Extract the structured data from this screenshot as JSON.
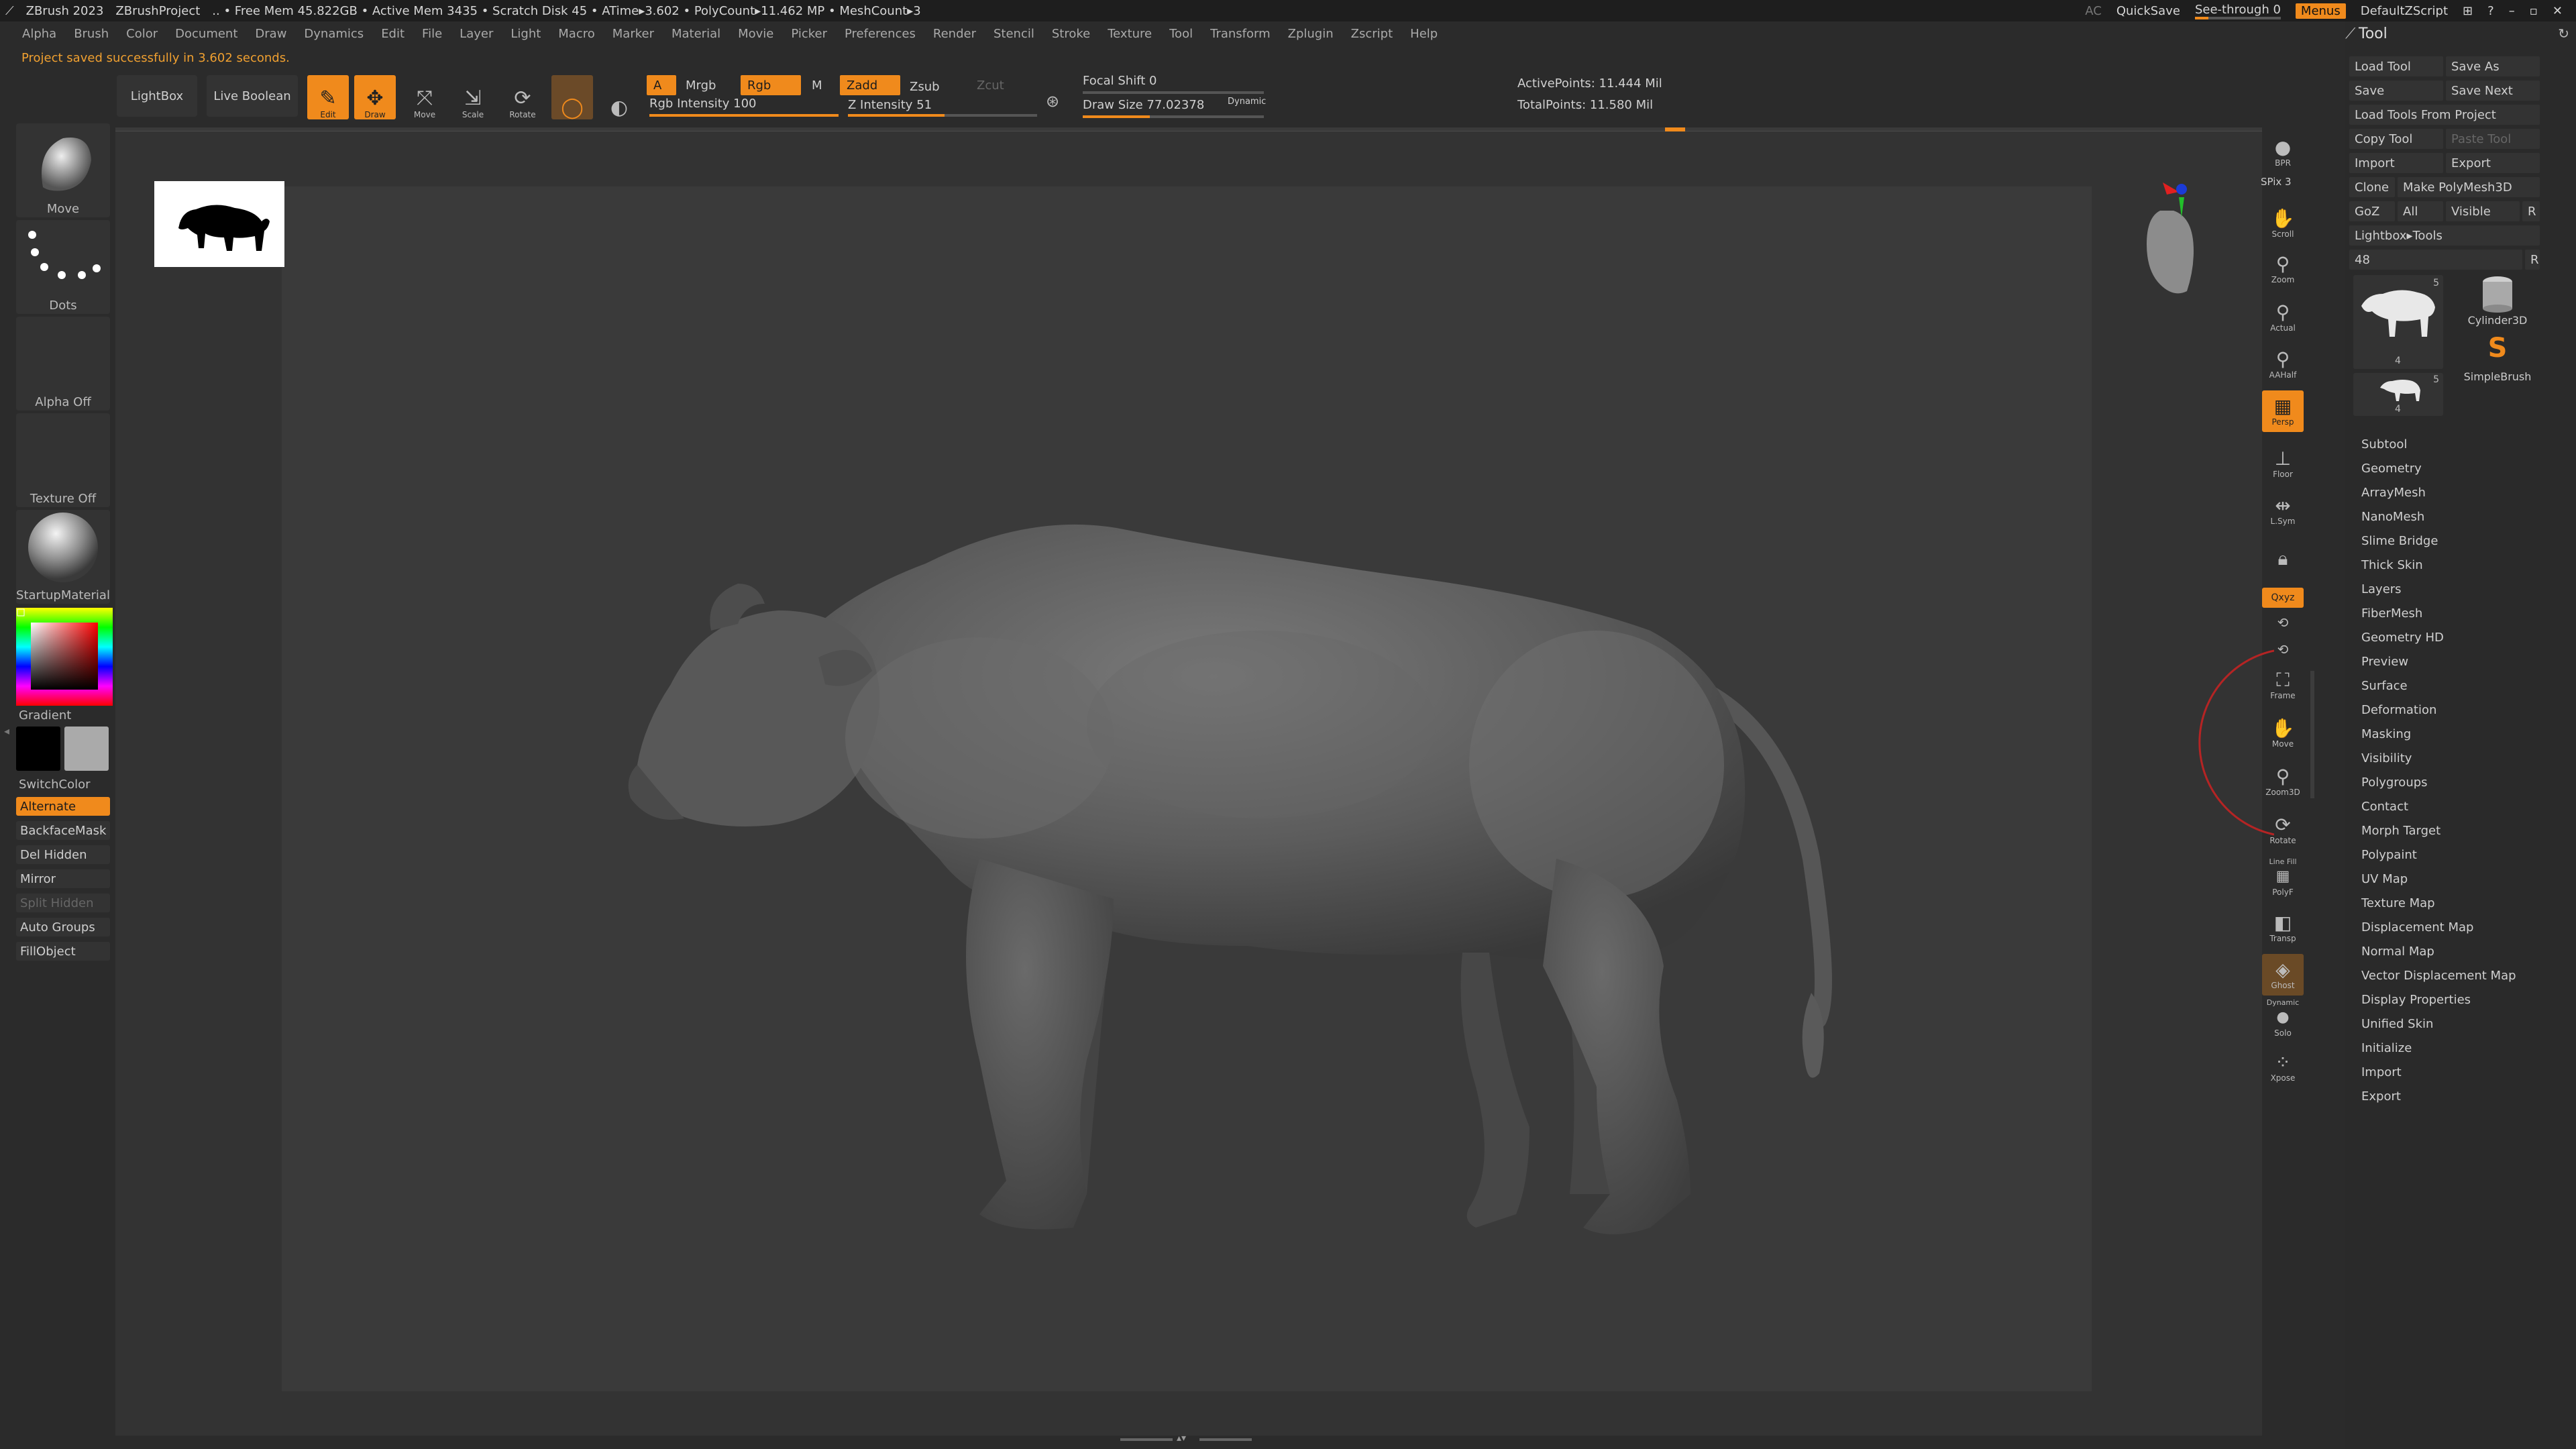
{
  "titlebar": {
    "app": "ZBrush 2023",
    "project": "ZBrushProject",
    "stats": ".. • Free Mem 45.822GB • Active Mem 3435 • Scratch Disk 45 • ATime▸3.602 • PolyCount▸11.462 MP • MeshCount▸3",
    "ac": "AC",
    "quicksave": "QuickSave",
    "seethrough": "See-through  0",
    "menus": "Menus",
    "script": "DefaultZScript"
  },
  "menubar": [
    "Alpha",
    "Brush",
    "Color",
    "Document",
    "Draw",
    "Dynamics",
    "Edit",
    "File",
    "Layer",
    "Light",
    "Macro",
    "Marker",
    "Material",
    "Movie",
    "Picker",
    "Preferences",
    "Render",
    "Stencil",
    "Stroke",
    "Texture",
    "Tool",
    "Transform",
    "Zplugin",
    "Zscript",
    "Help"
  ],
  "status": "Project saved successfully in 3.602 seconds.",
  "toolbar": {
    "lightbox": "LightBox",
    "live_boolean": "Live Boolean",
    "edit": "Edit",
    "draw": "Draw",
    "move": "Move",
    "scale": "Scale",
    "rotate": "Rotate",
    "a": "A",
    "mrgb": "Mrgb",
    "rgb": "Rgb",
    "m": "M",
    "zadd": "Zadd",
    "zsub": "Zsub",
    "zcut": "Zcut",
    "rgb_intensity": "Rgb Intensity 100",
    "z_intensity": "Z Intensity 51",
    "focal_shift": "Focal Shift 0",
    "draw_size": "Draw Size 77.02378",
    "dynamic": "Dynamic",
    "active_points": "ActivePoints: 11.444  Mil",
    "total_points": "TotalPoints: 11.580  Mil",
    "rgb_intensity_value": 100,
    "z_intensity_value": 51
  },
  "leftshelf": {
    "brush": "Move",
    "stroke": "Dots",
    "alpha": "Alpha Off",
    "texture": "Texture Off",
    "material": "StartupMaterial",
    "gradient": "Gradient",
    "switchcolor": "SwitchColor",
    "alternate": "Alternate",
    "backfacemask": "BackfaceMask",
    "del_hidden": "Del Hidden",
    "mirror": "Mirror",
    "split_hidden": "Split Hidden",
    "auto_groups": "Auto Groups",
    "fillobject": "FillObject"
  },
  "rightbar": {
    "bpr": "BPR",
    "spix": "SPix 3",
    "scroll": "Scroll",
    "zoom": "Zoom",
    "actual": "Actual",
    "aahalf": "AAHalf",
    "persp": "Persp",
    "floor": "Floor",
    "lsym": "L.Sym",
    "xyz": "Qxyz",
    "frame": "Frame",
    "move": "Move",
    "zoom3d": "Zoom3D",
    "rotate": "Rotate",
    "linefill": "Line Fill",
    "polyf": "PolyF",
    "transp": "Transp",
    "ghost": "Ghost",
    "dynamic": "Dynamic",
    "solo": "Solo",
    "xpose": "Xpose"
  },
  "toolpanel": {
    "title": "Tool",
    "load_tool": "Load Tool",
    "save_as": "Save As",
    "save": "Save",
    "save_next": "Save Next",
    "load_from_project": "Load Tools From Project",
    "copy_tool": "Copy Tool",
    "paste_tool": "Paste Tool",
    "import": "Import",
    "export": "Export",
    "clone": "Clone",
    "make_polymesh": "Make PolyMesh3D",
    "goz": "GoZ",
    "all": "All",
    "visible": "Visible",
    "r": "R",
    "lightbox_tools": "Lightbox▸Tools",
    "tool_count": "48",
    "thumb1_num": "5",
    "thumb1_count": "4",
    "thumb2_num": "5",
    "thumb2_count": "4",
    "cylinder": "Cylinder3D",
    "simplebrush": "SimpleBrush",
    "subpalettes": [
      "Subtool",
      "Geometry",
      "ArrayMesh",
      "NanoMesh",
      "Slime Bridge",
      "Thick Skin",
      "Layers",
      "FiberMesh",
      "Geometry HD",
      "Preview",
      "Surface",
      "Deformation",
      "Masking",
      "Visibility",
      "Polygroups",
      "Contact",
      "Morph Target",
      "Polypaint",
      "UV Map",
      "Texture Map",
      "Displacement Map",
      "Normal Map",
      "Vector Displacement Map",
      "Display Properties",
      "Unified Skin",
      "Initialize",
      "Import",
      "Export"
    ]
  },
  "colors": {
    "accent": "#f08a1c",
    "background": "#2b2b2b",
    "canvas": "#3a3a3a"
  }
}
